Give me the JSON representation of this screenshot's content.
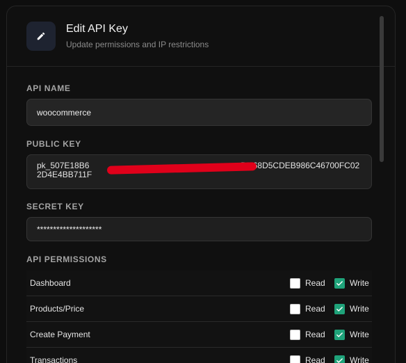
{
  "dialog": {
    "title": "Edit API Key",
    "subtitle": "Update permissions and IP restrictions",
    "header_icon": "pencil-icon"
  },
  "fields": {
    "api_name": {
      "label": "API NAME",
      "value": "woocommerce"
    },
    "public_key": {
      "label": "PUBLIC KEY",
      "value_start": "pk_507E18B6",
      "value_end": "DD68D5CDEB986C46700FC022D4E4BB711F"
    },
    "secret_key": {
      "label": "SECRET KEY",
      "value": "********************"
    }
  },
  "permissions": {
    "label": "API PERMISSIONS",
    "read_label": "Read",
    "write_label": "Write",
    "rows": [
      {
        "name": "Dashboard",
        "read": false,
        "write": true
      },
      {
        "name": "Products/Price",
        "read": false,
        "write": true
      },
      {
        "name": "Create Payment",
        "read": false,
        "write": true
      },
      {
        "name": "Transactions",
        "read": false,
        "write": true
      }
    ]
  },
  "colors": {
    "accent": "#1fa37a",
    "redaction": "#e0001a"
  }
}
